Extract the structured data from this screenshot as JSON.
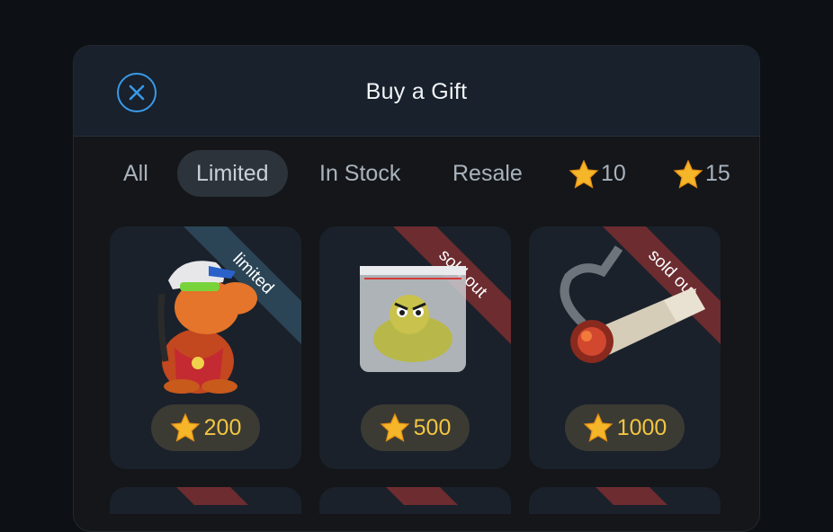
{
  "header": {
    "title": "Buy a Gift"
  },
  "tabs": [
    {
      "label": "All"
    },
    {
      "label": "Limited",
      "active": true
    },
    {
      "label": "In Stock"
    },
    {
      "label": "Resale"
    },
    {
      "label": "10",
      "icon": "star-icon"
    },
    {
      "label": "15",
      "icon": "star-icon"
    }
  ],
  "gifts": [
    {
      "name": "dog-with-cap",
      "ribbon": "limited",
      "ribbon_color": "#2b4557",
      "price": "200"
    },
    {
      "name": "bag",
      "ribbon": "sold out",
      "ribbon_color": "#6c2c30",
      "price": "500"
    },
    {
      "name": "joint",
      "ribbon": "sold out",
      "ribbon_color": "#6c2c30",
      "price": "1000"
    }
  ],
  "colors": {
    "accent": "#3a9ae8",
    "price_text": "#f3c542",
    "star": "#f5b62a"
  }
}
